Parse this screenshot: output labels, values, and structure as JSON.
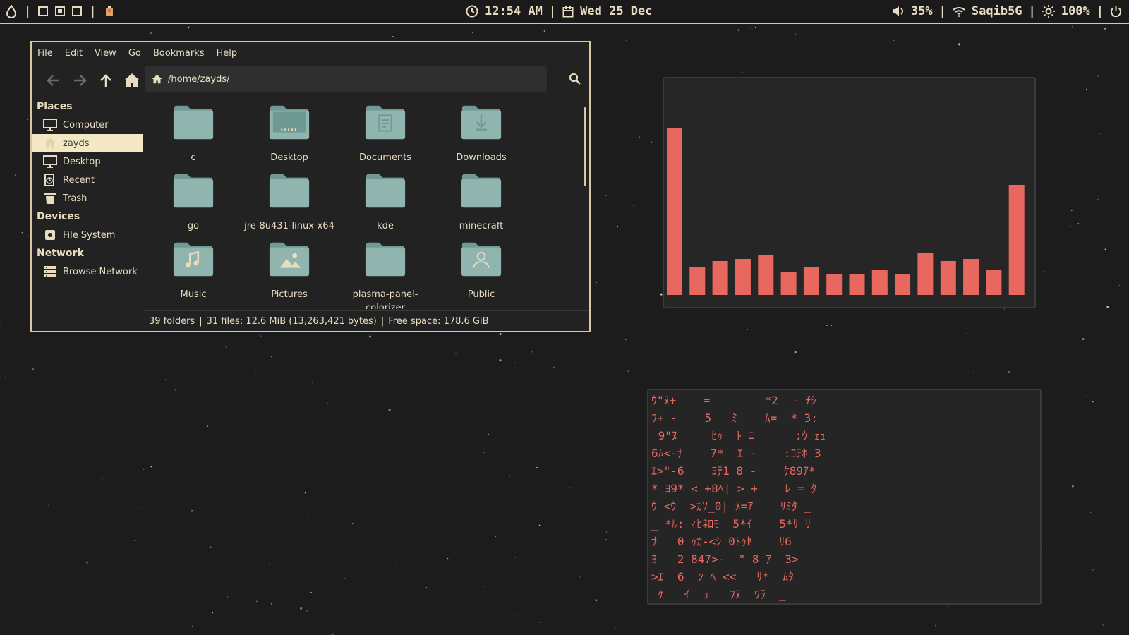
{
  "topbar": {
    "time": "12:54 AM",
    "date": "Wed 25 Dec",
    "volume": "35%",
    "wifi": "Saqib5G",
    "brightness": "100%",
    "separator": "|",
    "icons": [
      "drop-icon",
      "workspace-icon",
      "app-icon",
      "clock-icon",
      "calendar-icon",
      "volume-icon",
      "wifi-icon",
      "sun-icon",
      "power-icon"
    ]
  },
  "file_manager": {
    "menu": [
      "File",
      "Edit",
      "View",
      "Go",
      "Bookmarks",
      "Help"
    ],
    "path": "/home/zayds/",
    "sidebar": {
      "places_heading": "Places",
      "places": [
        {
          "label": "Computer",
          "icon": "monitor-icon"
        },
        {
          "label": "zayds",
          "icon": "home-icon"
        },
        {
          "label": "Desktop",
          "icon": "monitor-icon"
        },
        {
          "label": "Recent",
          "icon": "recent-icon"
        },
        {
          "label": "Trash",
          "icon": "trash-icon"
        }
      ],
      "devices_heading": "Devices",
      "devices": [
        {
          "label": "File System",
          "icon": "drive-icon"
        }
      ],
      "network_heading": "Network",
      "network": [
        {
          "label": "Browse Network",
          "icon": "network-icon"
        }
      ]
    },
    "items": [
      {
        "name": "c",
        "type": "folder"
      },
      {
        "name": "Desktop",
        "type": "desktop"
      },
      {
        "name": "Documents",
        "type": "documents"
      },
      {
        "name": "Downloads",
        "type": "downloads"
      },
      {
        "name": "go",
        "type": "folder"
      },
      {
        "name": "jre-8u431-linux-x64",
        "type": "folder"
      },
      {
        "name": "kde",
        "type": "folder"
      },
      {
        "name": "minecraft",
        "type": "folder"
      },
      {
        "name": "Music",
        "type": "music"
      },
      {
        "name": "Pictures",
        "type": "pictures"
      },
      {
        "name": "plasma-panel-colorizer",
        "type": "folder"
      },
      {
        "name": "Public",
        "type": "public"
      }
    ],
    "status": {
      "folders": "39 folders",
      "files": "31 files: 12.6 MiB (13,263,421 bytes)",
      "free": "Free space: 178.6 GiB",
      "separator": "|"
    }
  },
  "visualizer": {
    "bar_color": "#e8685f",
    "levels": [
      0.79,
      0.13,
      0.16,
      0.17,
      0.19,
      0.11,
      0.13,
      0.1,
      0.1,
      0.12,
      0.1,
      0.2,
      0.16,
      0.17,
      0.12,
      0.52
    ]
  },
  "matrix_text": [
    "ｳ\"ﾇ+    =        *2  - ﾁｼ",
    "ﾌ+ -    5   ﾐ    ﾑ=  * 3:",
    "_9\"ﾇ     ﾋｩ  ﾄ ﾆ      :ｳ ｪｭ",
    "6ﾑ<-ﾅ    7*  ｴ -    :ｺﾃﾎ 3",
    "ｴ>\"-6    ﾖﾃ1 8 -    ｹ89ｱ*",
    "* ﾖ9* < +8ﾍ| > +    ﾚ_= ﾀ",
    "ｳ <ｳ  >ｶｿ_0| ﾒ=ｱ    ﾘﾐﾀ _",
    "_ *ﾙ: ｨﾋﾈﾛﾓ  5*ｲ    5*ﾘ ﾘ",
    "ｻ   0 ｩｶ-<ｼ 0ﾄｩｾ    ﾘ6",
    "ﾖ   2 847>-  \" 8 ｱ  3>",
    ">ｴ  6  ﾝ ﾍ <<  _ﾘ*  ﾑﾀ",
    " ｹ   ｲ  ｭ   ﾌﾇ  ﾜﾗ  _"
  ],
  "colors": {
    "accent": "#d9c9a3",
    "folder": "#8fb5ae",
    "folder_dark": "#6f9a93",
    "bar": "#e8685f",
    "selected_bg": "#f2e8c4"
  }
}
